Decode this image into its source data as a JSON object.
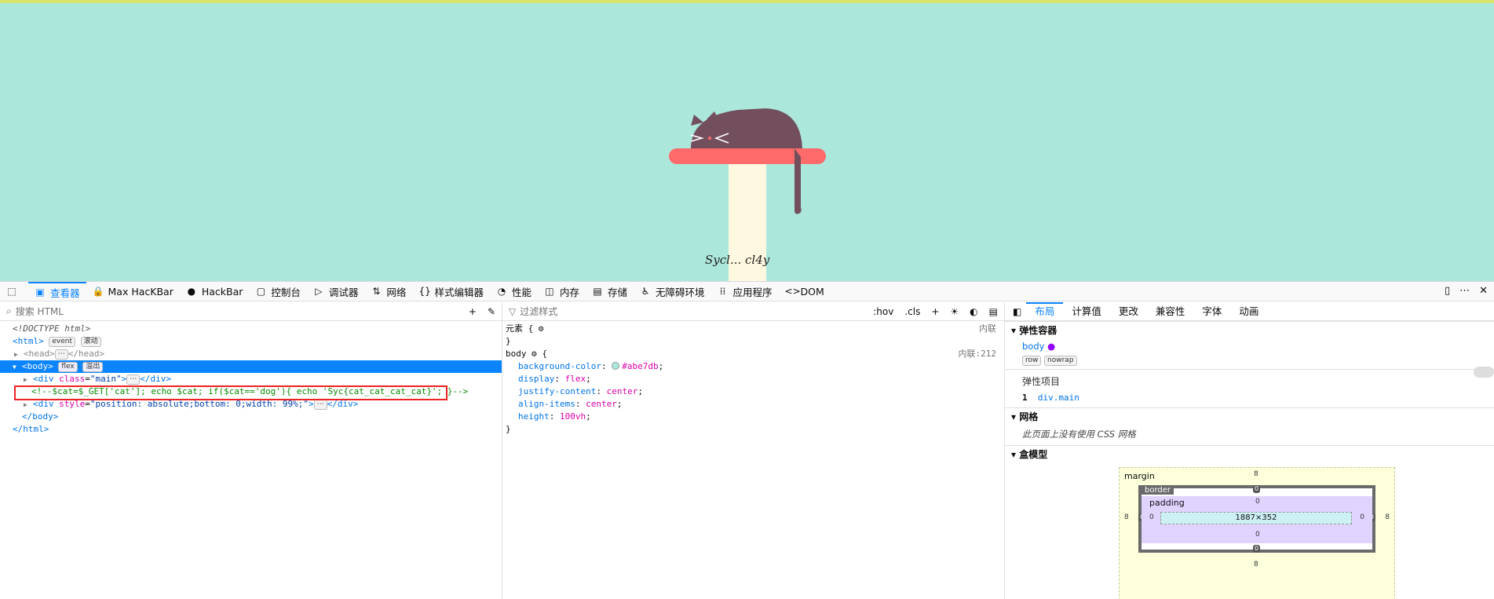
{
  "page": {
    "signature": "Sycl... cl4y",
    "background": "#abe7db"
  },
  "toolbar": {
    "picker_icon": "element-picker-icon",
    "items": [
      {
        "icon": "inspector-icon",
        "label": "查看器",
        "glyph": "▣"
      },
      {
        "icon": "lock-icon",
        "label": "Max HacKBar",
        "glyph": "🔒"
      },
      {
        "icon": "globe-icon",
        "label": "HackBar",
        "glyph": "●"
      },
      {
        "icon": "console-icon",
        "label": "控制台",
        "glyph": "▢"
      },
      {
        "icon": "debugger-icon",
        "label": "调试器",
        "glyph": "▷"
      },
      {
        "icon": "network-icon",
        "label": "网络",
        "glyph": "⇅"
      },
      {
        "icon": "style-editor-icon",
        "label": "样式编辑器",
        "glyph": "{}"
      },
      {
        "icon": "performance-icon",
        "label": "性能",
        "glyph": "◔"
      },
      {
        "icon": "memory-icon",
        "label": "内存",
        "glyph": "◫"
      },
      {
        "icon": "storage-icon",
        "label": "存储",
        "glyph": "▤"
      },
      {
        "icon": "accessibility-icon",
        "label": "无障碍环境",
        "glyph": "♿"
      },
      {
        "icon": "application-icon",
        "label": "应用程序",
        "glyph": "⁞⁞"
      },
      {
        "icon": "dom-icon",
        "label": "DOM",
        "glyph": "<>"
      }
    ]
  },
  "inspector": {
    "search_placeholder": "搜索 HTML",
    "lines": {
      "doctype": "<!DOCTYPE html>",
      "html_open": "<html>",
      "badge_event": "event",
      "badge_scroll": "滚动",
      "head": "<head>",
      "head_close": "</head>",
      "body_open": "<body>",
      "badge_flex": "flex",
      "badge_overflow": "溢出",
      "div_main_tag": "div",
      "div_main_attr": "class",
      "div_main_val": "\"main\"",
      "div_close": "</div>",
      "comment": "<!--$cat=$_GET['cat']; echo $cat; if($cat=='dog'){ echo 'Syc{cat_cat_cat_cat}'; }-->",
      "div2_tag": "div",
      "div2_attr": "style",
      "div2_val": "\"position: absolute;bottom: 0;width: 99%;\"",
      "body_close": "</body>",
      "html_close": "</html>",
      "ellipsis": "⋯"
    }
  },
  "rules": {
    "filter_placeholder": "过滤样式",
    "hov": ":hov",
    "cls": ".cls",
    "element_rule": "元素 {",
    "close": "}",
    "inline_label": "内联",
    "body_selector": "body",
    "body_source": "内联:212",
    "declarations": [
      {
        "prop": "background-color",
        "value": "#abe7db"
      },
      {
        "prop": "display",
        "value": "flex"
      },
      {
        "prop": "justify-content",
        "value": "center"
      },
      {
        "prop": "align-items",
        "value": "center"
      },
      {
        "prop": "height",
        "value": "100vh"
      }
    ]
  },
  "layout": {
    "tabs": [
      "布局",
      "计算值",
      "更改",
      "兼容性",
      "字体",
      "动画"
    ],
    "flex_container": "弹性容器",
    "flex_body": "body",
    "flex_row": "row",
    "flex_nowrap": "nowrap",
    "flex_items": "弹性项目",
    "flex_item_index": "1",
    "flex_item_name": "div.main",
    "grid": "网格",
    "grid_note": "此页面上没有使用 CSS 网格",
    "box_model": "盒模型",
    "bm_margin": "margin",
    "bm_border": "border",
    "bm_padding": "padding",
    "bm_content": "1887×352",
    "bm_margin_val": "8",
    "bm_zero": "0"
  }
}
